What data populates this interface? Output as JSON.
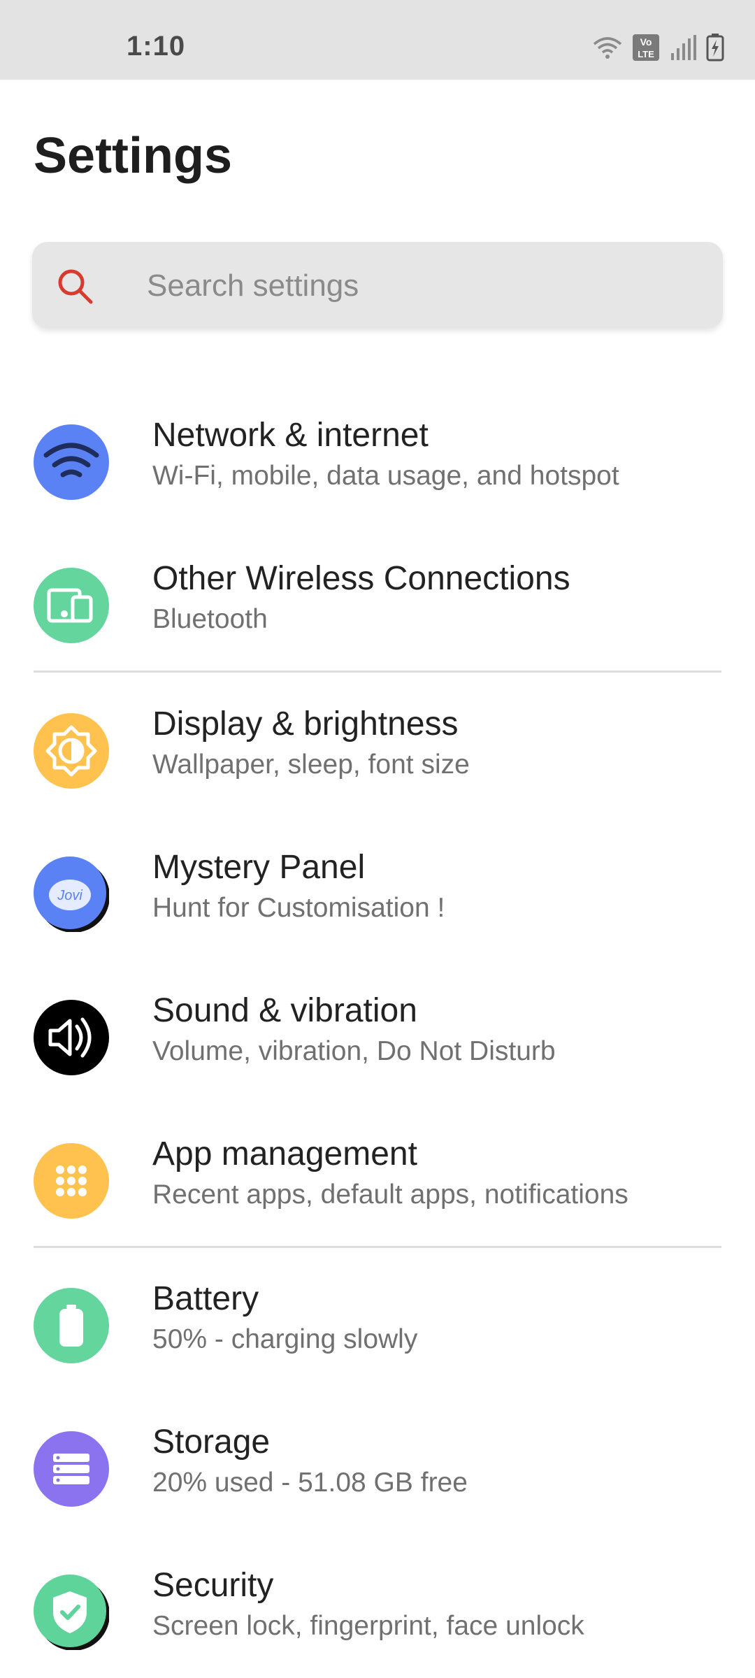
{
  "status_bar": {
    "time": "1:10",
    "icons": [
      "wifi-icon",
      "volte-icon",
      "signal-icon",
      "battery-charging-icon"
    ]
  },
  "page": {
    "title": "Settings"
  },
  "search": {
    "placeholder": "Search settings",
    "icon": "search-icon",
    "accent": "#d93a2f"
  },
  "items": [
    {
      "title": "Network & internet",
      "subtitle": "Wi-Fi, mobile, data usage, and hotspot",
      "icon": "wifi-icon",
      "color": "#5b82f5"
    },
    {
      "title": "Other Wireless Connections",
      "subtitle": "Bluetooth",
      "icon": "devices-icon",
      "color": "#64d59d"
    },
    {
      "title": "Display & brightness",
      "subtitle": "Wallpaper, sleep, font size",
      "icon": "brightness-icon",
      "color": "#ffc24e"
    },
    {
      "title": "Mystery Panel",
      "subtitle": "Hunt for Customisation !",
      "icon": "jovi-icon",
      "color": "#5b82f5",
      "icon_text": "Jovi"
    },
    {
      "title": "Sound & vibration",
      "subtitle": "Volume, vibration, Do Not Disturb",
      "icon": "speaker-icon",
      "color": "#000000"
    },
    {
      "title": "App management",
      "subtitle": "Recent apps, default apps, notifications",
      "icon": "apps-grid-icon",
      "color": "#ffc24e"
    },
    {
      "title": "Battery",
      "subtitle": "50% - charging slowly",
      "icon": "battery-icon",
      "color": "#64d59d"
    },
    {
      "title": "Storage",
      "subtitle": "20% used - 51.08 GB free",
      "icon": "storage-icon",
      "color": "#8b73f0"
    },
    {
      "title": "Security",
      "subtitle": "Screen lock, fingerprint, face unlock",
      "icon": "shield-icon",
      "color": "#5fd49a"
    }
  ]
}
